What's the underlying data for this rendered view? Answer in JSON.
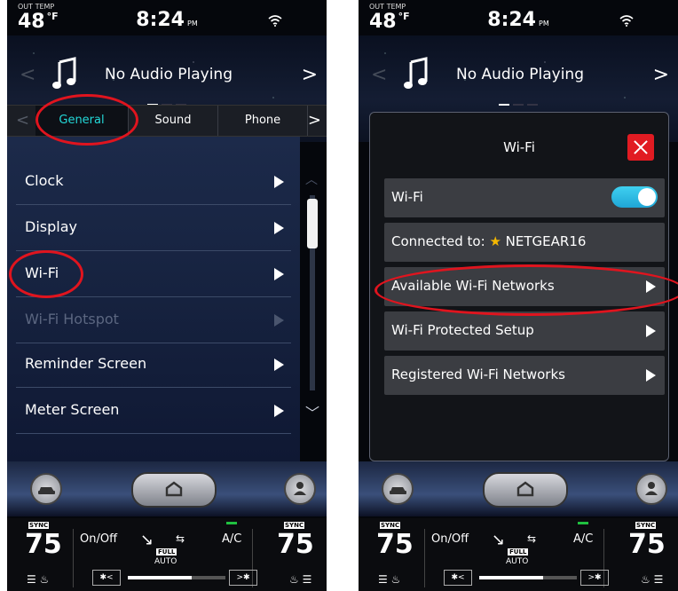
{
  "status": {
    "temp_label": "OUT TEMP",
    "temp_value": "48",
    "temp_unit": "°F",
    "time": "8:24",
    "ampm": "PM"
  },
  "audio": {
    "text": "No Audio Playing"
  },
  "tabs": [
    {
      "label": "General"
    },
    {
      "label": "Sound"
    },
    {
      "label": "Phone"
    }
  ],
  "settings": {
    "items": [
      {
        "label": "Clock",
        "enabled": true
      },
      {
        "label": "Display",
        "enabled": true
      },
      {
        "label": "Wi-Fi",
        "enabled": true
      },
      {
        "label": "Wi-Fi Hotspot",
        "enabled": false
      },
      {
        "label": "Reminder Screen",
        "enabled": true
      },
      {
        "label": "Meter Screen",
        "enabled": true
      }
    ]
  },
  "wifi_popup": {
    "title": "Wi-Fi",
    "toggle_label": "Wi-Fi",
    "toggle_on": true,
    "connected_prefix": "Connected to:",
    "connected_network": "NETGEAR16",
    "rows": [
      {
        "label": "Available Wi-Fi Networks"
      },
      {
        "label": "Wi-Fi Protected Setup"
      },
      {
        "label": "Registered Wi-Fi Networks"
      }
    ]
  },
  "climate": {
    "sync_label": "SYNC",
    "left_temp": "75",
    "right_temp": "75",
    "onoff_label": "On/Off",
    "ac_label": "A/C",
    "full_label": "FULL",
    "auto_label": "AUTO",
    "fan_level": 0.65
  },
  "colors": {
    "accent": "#23d8d8",
    "annotation": "#e0141e",
    "toggle_on": "#2ab8e4",
    "close": "#e11b22",
    "star": "#f5b800"
  }
}
